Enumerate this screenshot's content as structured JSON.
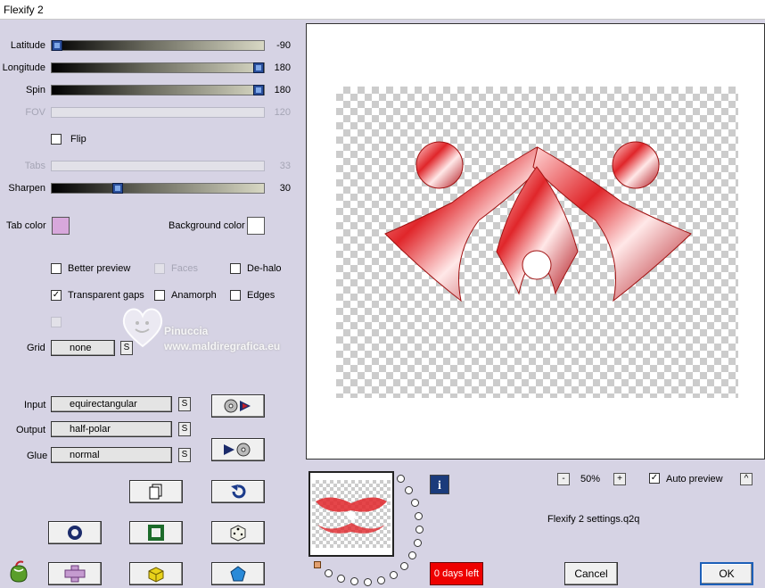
{
  "window": {
    "title": "Flexify 2"
  },
  "sliders": [
    {
      "label": "Latitude",
      "value": "-90",
      "fraction": 0.0,
      "enabled": true
    },
    {
      "label": "Longitude",
      "value": "180",
      "fraction": 1.0,
      "enabled": true
    },
    {
      "label": "Spin",
      "value": "180",
      "fraction": 1.0,
      "enabled": true
    },
    {
      "label": "FOV",
      "value": "120",
      "fraction": null,
      "enabled": false
    },
    {
      "label": "Tabs",
      "value": "33",
      "fraction": null,
      "enabled": false
    },
    {
      "label": "Sharpen",
      "value": "30",
      "fraction": 0.3,
      "enabled": true
    }
  ],
  "flip": {
    "label": "Flip",
    "checked": false
  },
  "tab_color": {
    "label": "Tab color",
    "color": "#d8a8dc"
  },
  "background_color": {
    "label": "Background color",
    "color": "#ffffff"
  },
  "options": {
    "better_preview": {
      "label": "Better preview",
      "checked": false
    },
    "faces": {
      "label": "Faces",
      "checked": false,
      "enabled": false
    },
    "de_halo": {
      "label": "De-halo",
      "checked": false
    },
    "transparent_gaps": {
      "label": "Transparent gaps",
      "checked": true
    },
    "anamorph": {
      "label": "Anamorph",
      "checked": false
    },
    "edges": {
      "label": "Edges",
      "checked": false
    }
  },
  "grid": {
    "label": "Grid",
    "value": "none",
    "s_label": "S"
  },
  "input": {
    "label": "Input",
    "value": "equirectangular",
    "s_label": "S"
  },
  "output": {
    "label": "Output",
    "value": "half-polar",
    "s_label": "S"
  },
  "glue": {
    "label": "Glue",
    "value": "normal",
    "s_label": "S"
  },
  "watermark": {
    "name": "Pinuccia",
    "site": "www.maldiregrafica.eu"
  },
  "zoom": {
    "minus": "-",
    "value": "50%",
    "plus": "+"
  },
  "auto_preview": {
    "label": "Auto preview",
    "checked": true,
    "caret": "^"
  },
  "settings_file": "Flexify 2 settings.q2q",
  "info_label": "i",
  "trial": "0 days left",
  "buttons": {
    "cancel": "Cancel",
    "ok": "OK"
  },
  "colors": {
    "accent": "#1c5fb8",
    "trial_bg": "#ee0000",
    "shape_red": "#e0262a"
  }
}
